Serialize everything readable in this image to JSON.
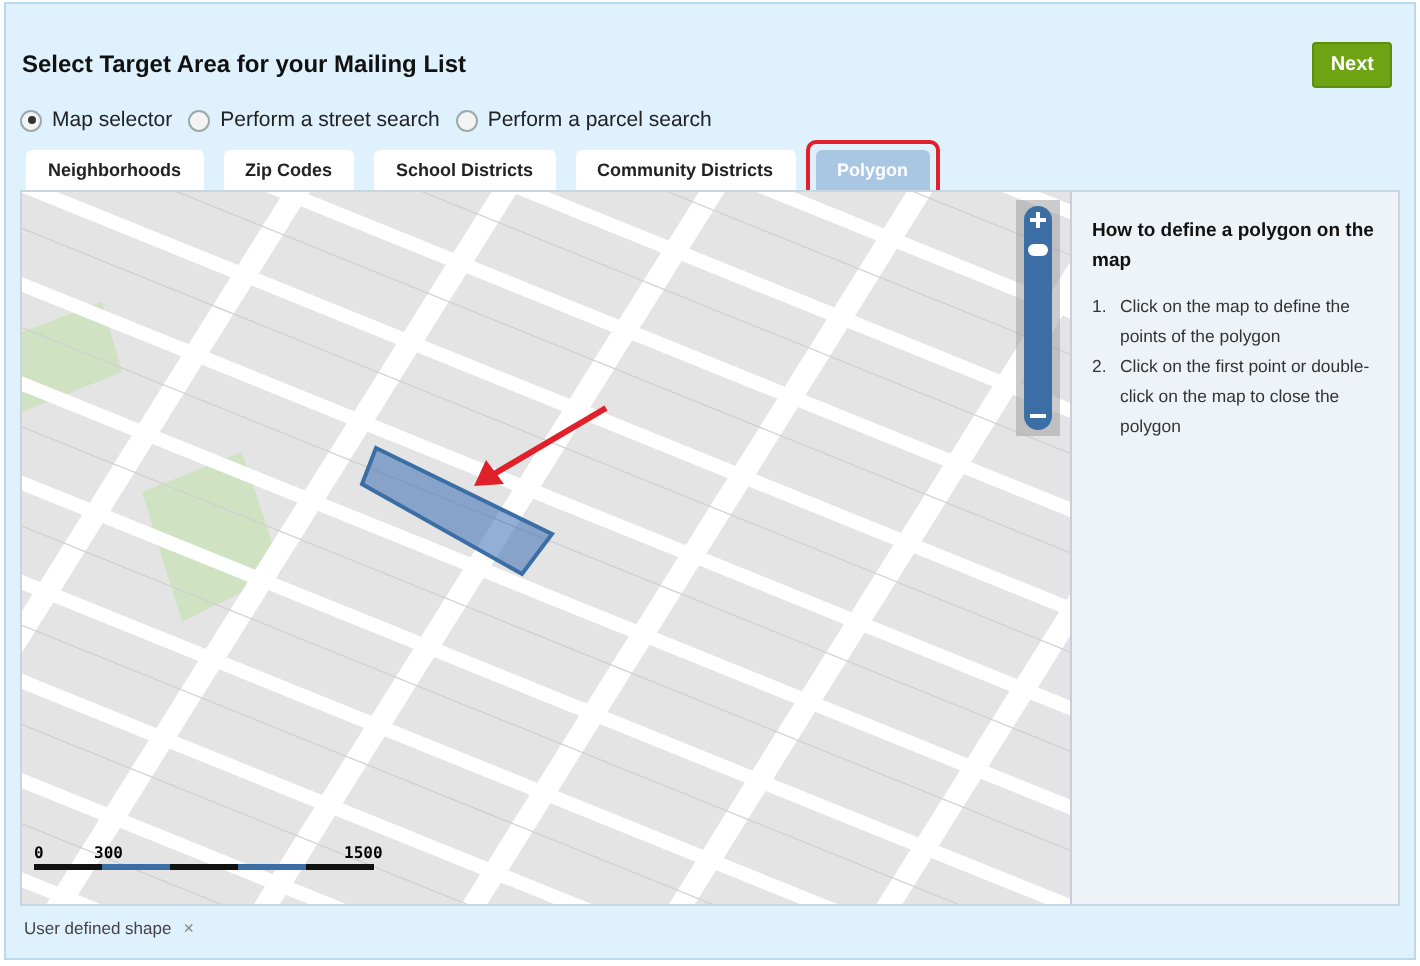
{
  "header": {
    "title": "Select Target Area for your Mailing List",
    "next_button": "Next"
  },
  "modes": [
    {
      "label": "Map selector",
      "selected": true
    },
    {
      "label": "Perform a street search",
      "selected": false
    },
    {
      "label": "Perform a parcel search",
      "selected": false
    }
  ],
  "tabs": [
    {
      "label": "Neighborhoods",
      "selected": false,
      "highlighted": false
    },
    {
      "label": "Zip Codes",
      "selected": false,
      "highlighted": false
    },
    {
      "label": "School Districts",
      "selected": false,
      "highlighted": false
    },
    {
      "label": "Community Districts",
      "selected": false,
      "highlighted": false
    },
    {
      "label": "Polygon",
      "selected": true,
      "highlighted": true
    }
  ],
  "map": {
    "zoom": {
      "level": 0.8
    },
    "scale_labels": [
      "0",
      "300",
      "1500"
    ]
  },
  "help": {
    "title": "How to define a polygon on the map",
    "steps": [
      {
        "number": "1.",
        "text": "Click on the map to define the points of the polygon"
      },
      {
        "number": "2.",
        "text": "Click on the first point or double-click on the map to close the polygon"
      }
    ]
  },
  "footer": {
    "shape_label": "User defined shape",
    "remove": "×"
  }
}
